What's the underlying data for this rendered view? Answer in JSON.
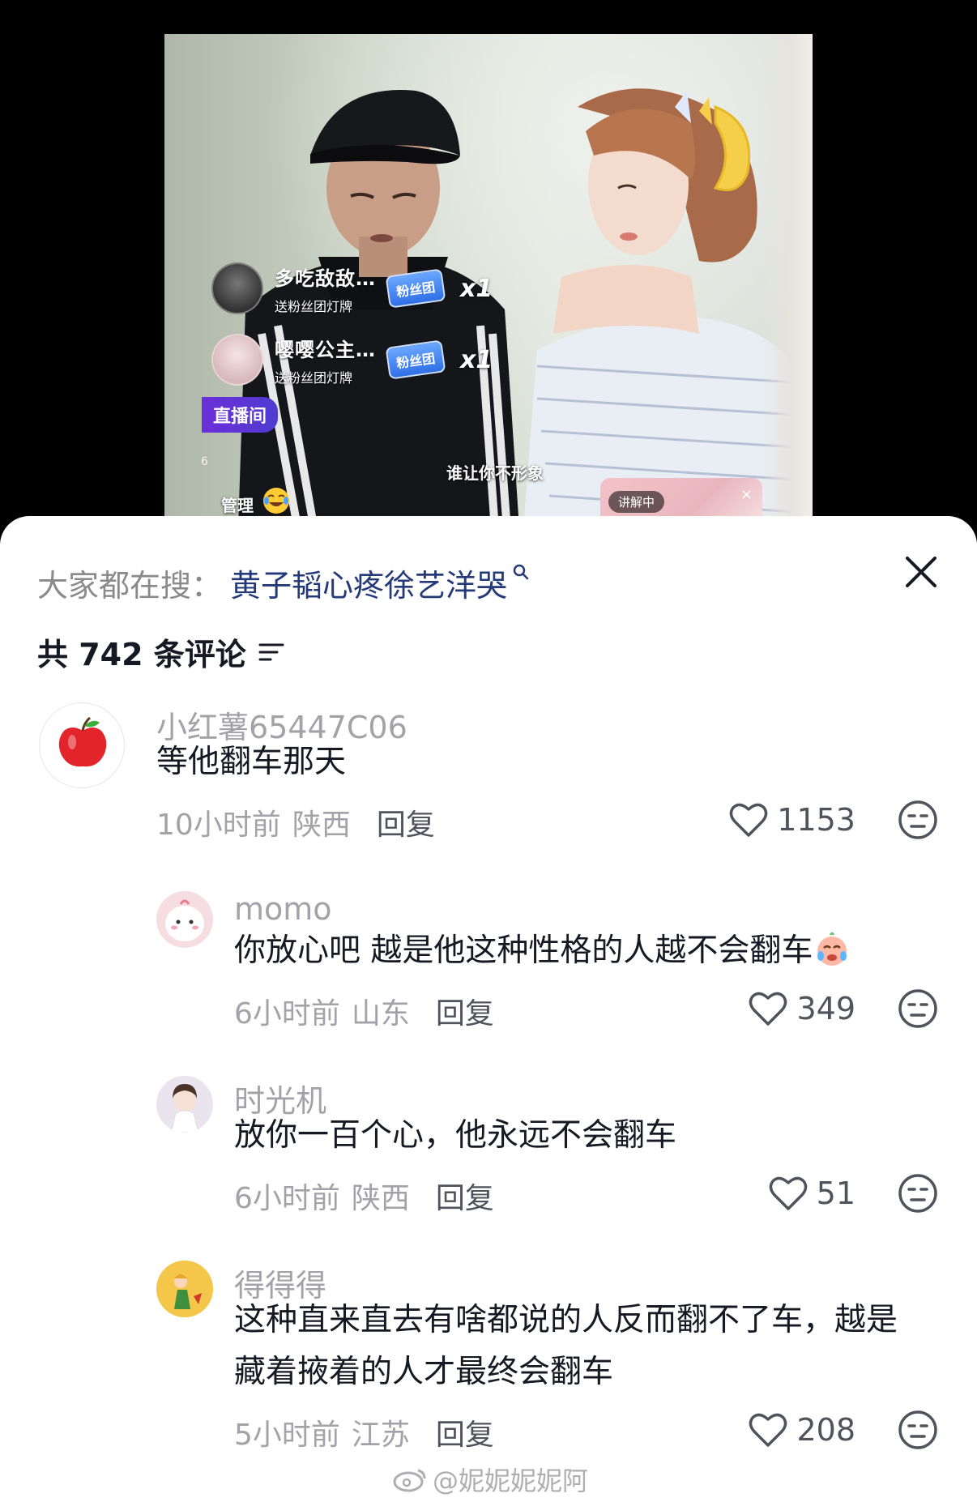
{
  "video": {
    "gifts": [
      {
        "name": "多吃敌敌…",
        "sub": "送粉丝团灯牌",
        "badge": "粉丝团",
        "count": "x1"
      },
      {
        "name": "嘤嘤公主…",
        "sub": "送粉丝团灯牌",
        "badge": "粉丝团",
        "count": "x1"
      }
    ],
    "live_tag": "直播间",
    "live_small": "6",
    "overlay_text": "谁让你不形象",
    "manage_tag": "管理",
    "explain_label": "讲解中",
    "explain_close": "×"
  },
  "sheet": {
    "search_label": "大家都在搜：",
    "search_term": "黄子韬心疼徐艺洋哭",
    "comment_count": "共 742 条评论",
    "colors": {
      "search_term": "#243a78",
      "text": "#161823",
      "muted": "#a2a2a8"
    }
  },
  "comments": [
    {
      "author": "小红薯65447C06",
      "text": "等他翻车那天",
      "time": "10小时前",
      "location": "陕西",
      "reply": "回复",
      "likes": "1153",
      "avatar": "apple-avatar"
    },
    {
      "author": "momo",
      "text": "你放心吧 越是他这种性格的人越不会翻车",
      "time": "6小时前",
      "location": "山东",
      "reply": "回复",
      "likes": "349",
      "avatar": "cartoon-avatar"
    },
    {
      "author": "时光机",
      "text": "放你一百个心，他永远不会翻车",
      "time": "6小时前",
      "location": "陕西",
      "reply": "回复",
      "likes": "51",
      "avatar": "girl-avatar"
    },
    {
      "author": "得得得",
      "text": "这种直来直去有啥都说的人反而翻不了车，越是藏着掖着的人才最终会翻车",
      "time": "5小时前",
      "location": "江苏",
      "reply": "回复",
      "likes": "208",
      "avatar": "little-prince-avatar"
    }
  ],
  "watermark": "@妮妮妮妮阿"
}
